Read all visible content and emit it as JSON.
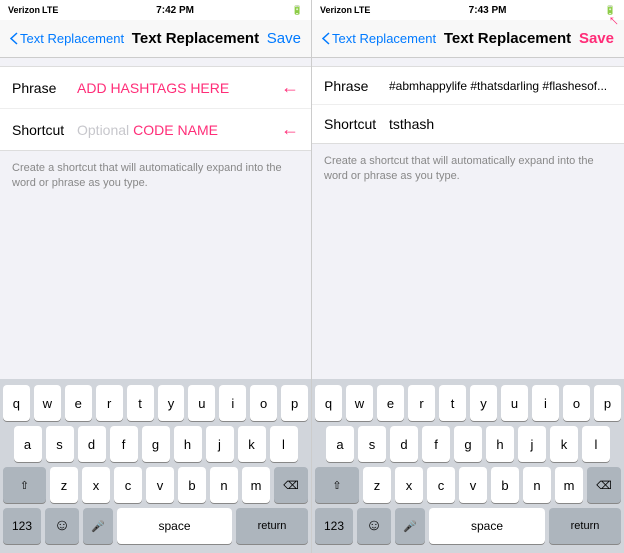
{
  "left": {
    "status": {
      "carrier": "Verizon",
      "network": "LTE",
      "time": "7:42 PM",
      "icons": "▲ ⊿ ▐▐"
    },
    "nav": {
      "back_label": "Text Replacement",
      "title": "Text Replacement",
      "save_label": "Save"
    },
    "form": {
      "phrase_label": "Phrase",
      "phrase_value": "ADD HASHTAGS HERE",
      "shortcut_label": "Shortcut",
      "shortcut_optional": "Optional",
      "shortcut_value": "CODE NAME"
    },
    "description": "Create a shortcut that will automatically expand into the word or phrase as you type.",
    "keyboard": {
      "row1": [
        "q",
        "w",
        "e",
        "r",
        "t",
        "y",
        "u",
        "i",
        "o",
        "p"
      ],
      "row2": [
        "a",
        "s",
        "d",
        "f",
        "g",
        "h",
        "j",
        "k",
        "l"
      ],
      "row3": [
        "z",
        "x",
        "c",
        "v",
        "b",
        "n",
        "m"
      ],
      "space": "space",
      "return": "return",
      "num": "123"
    }
  },
  "right": {
    "status": {
      "carrier": "Verizon",
      "network": "LTE",
      "time": "7:43 PM",
      "icons": "▲ ⊿ ▐▐"
    },
    "nav": {
      "back_label": "Text Replacement",
      "title": "Text Replacement",
      "save_label": "Save"
    },
    "form": {
      "phrase_label": "Phrase",
      "phrase_value": "#abmhappylife #thatsdarling #flashesof...",
      "shortcut_label": "Shortcut",
      "shortcut_value": "tsthash"
    },
    "description": "Create a shortcut that will automatically expand into the word or phrase as you type.",
    "keyboard": {
      "row1": [
        "q",
        "w",
        "e",
        "r",
        "t",
        "y",
        "u",
        "i",
        "o",
        "p"
      ],
      "row2": [
        "a",
        "s",
        "d",
        "f",
        "g",
        "h",
        "j",
        "k",
        "l"
      ],
      "row3": [
        "z",
        "x",
        "c",
        "v",
        "b",
        "n",
        "m"
      ],
      "space": "space",
      "return": "return",
      "num": "123"
    }
  }
}
